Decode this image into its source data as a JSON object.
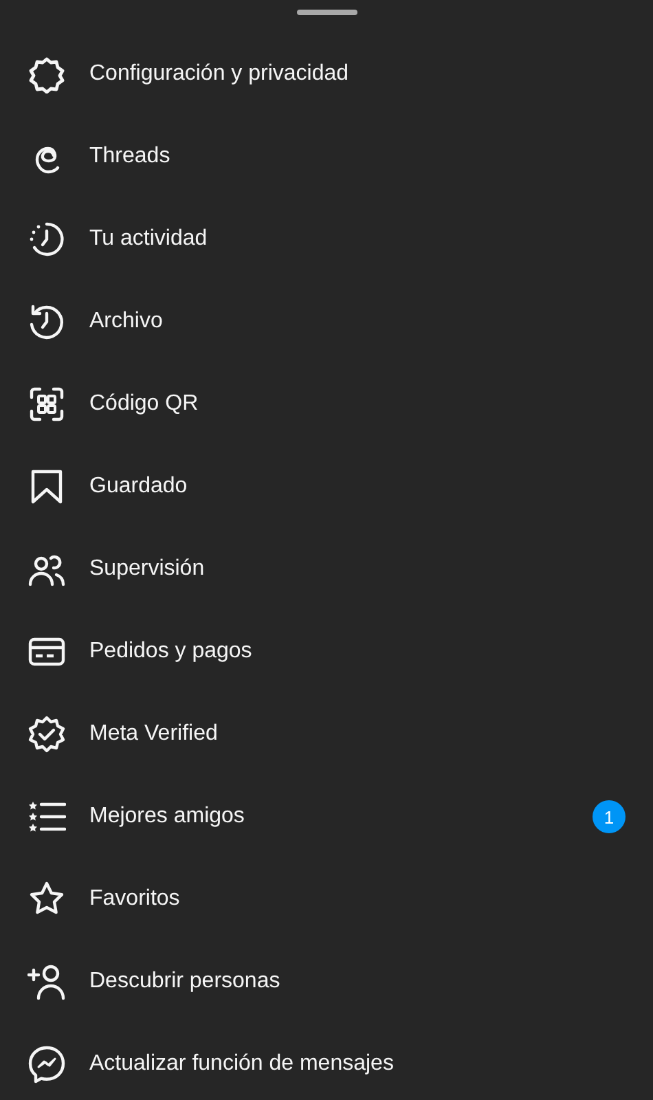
{
  "menu": {
    "items": [
      {
        "kind": "settings",
        "label": "Configuración y privacidad"
      },
      {
        "kind": "threads",
        "label": "Threads"
      },
      {
        "kind": "activity",
        "label": "Tu actividad"
      },
      {
        "kind": "archive",
        "label": "Archivo"
      },
      {
        "kind": "qr",
        "label": "Código QR"
      },
      {
        "kind": "bookmark",
        "label": "Guardado"
      },
      {
        "kind": "people",
        "label": "Supervisión"
      },
      {
        "kind": "card",
        "label": "Pedidos y pagos"
      },
      {
        "kind": "verified",
        "label": "Meta Verified"
      },
      {
        "kind": "starlist",
        "label": "Mejores amigos",
        "badge": "1"
      },
      {
        "kind": "star",
        "label": "Favoritos"
      },
      {
        "kind": "addperson",
        "label": "Descubrir personas"
      },
      {
        "kind": "messenger",
        "label": "Actualizar función de mensajes"
      }
    ]
  }
}
